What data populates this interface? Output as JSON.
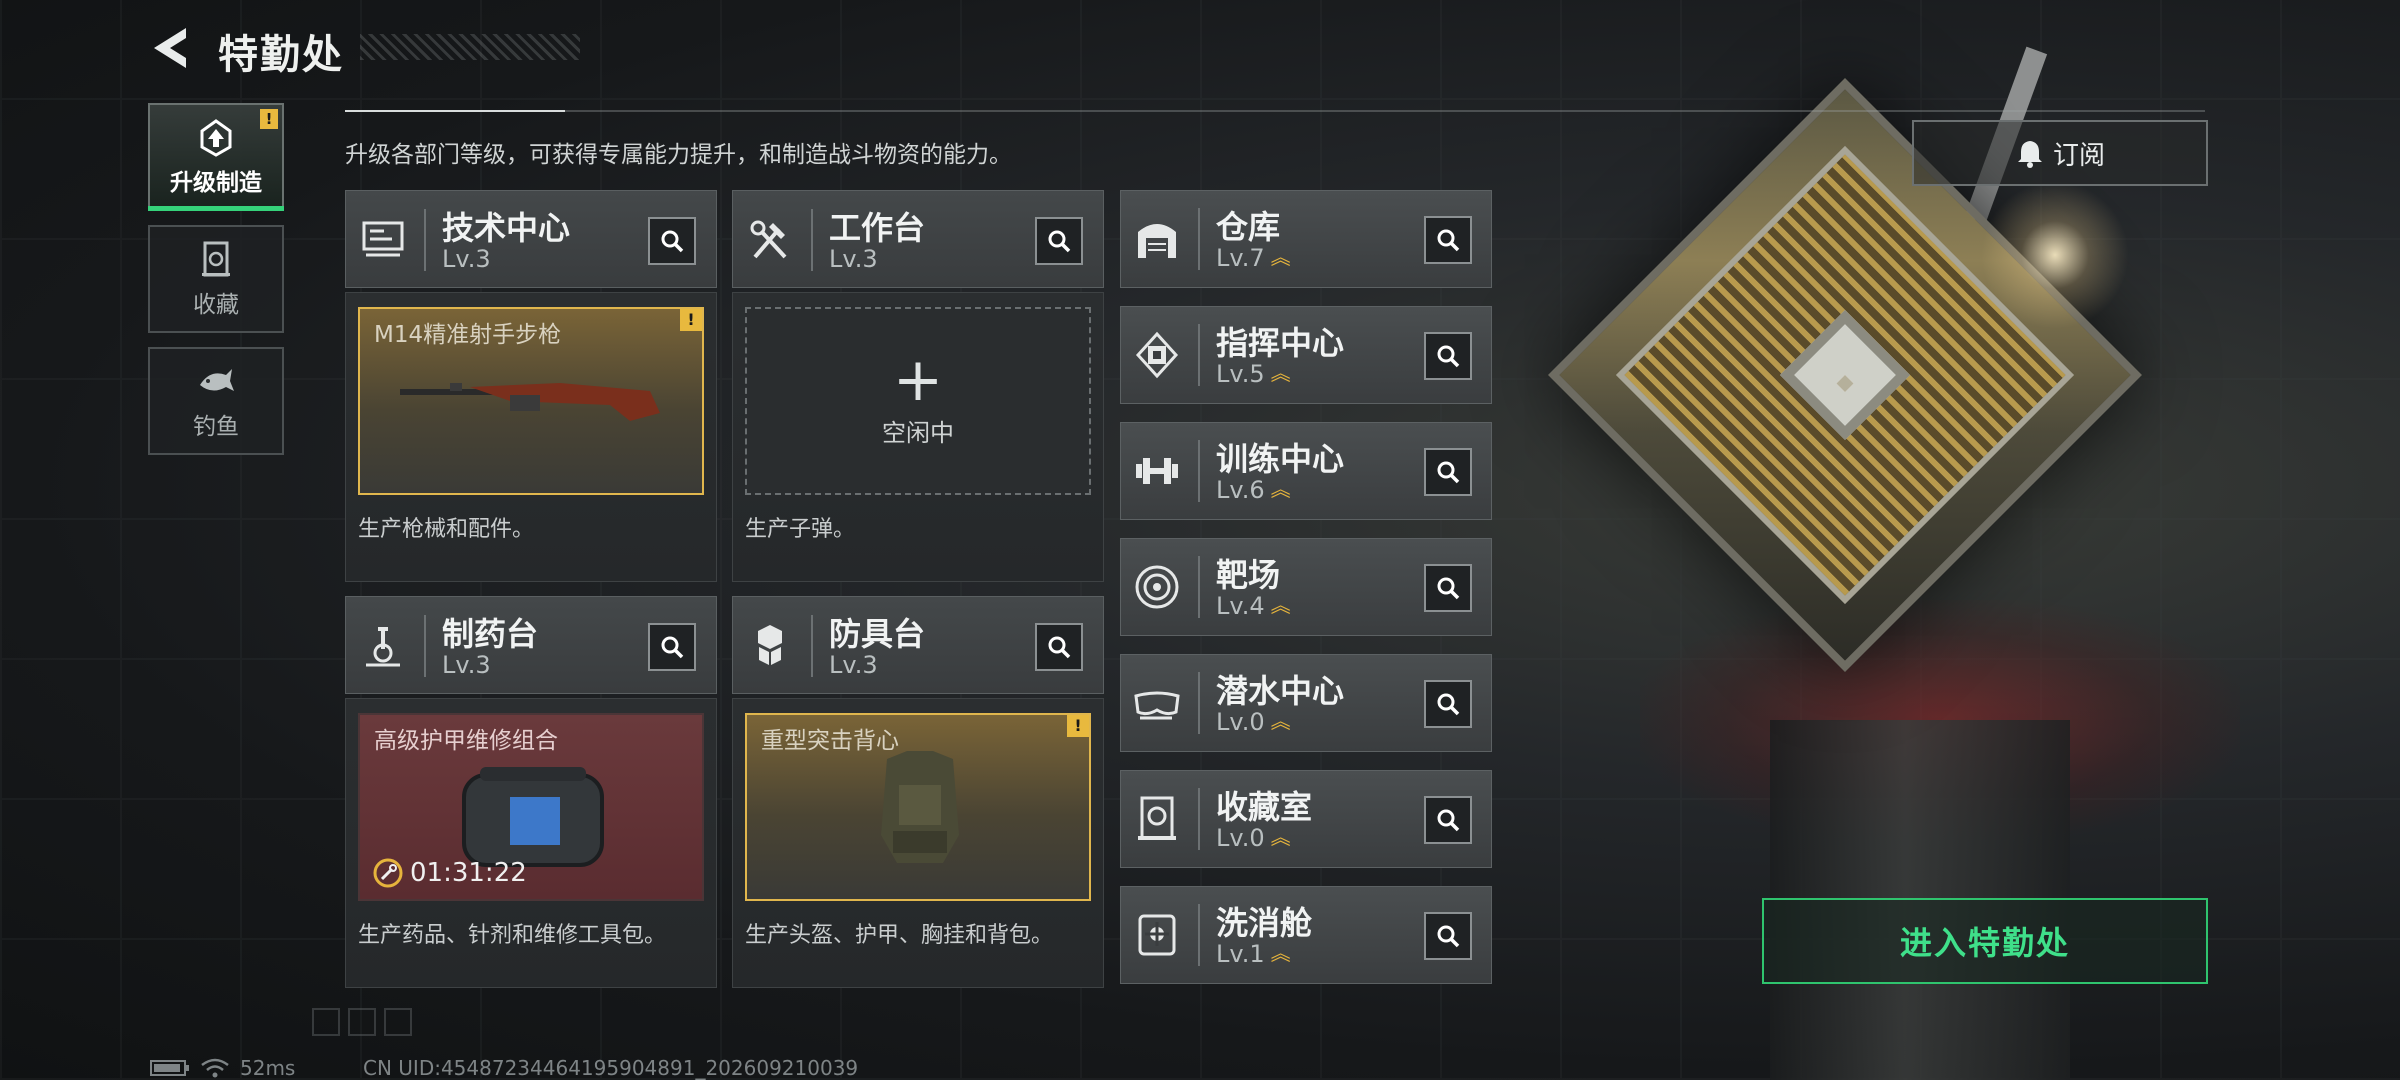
{
  "header": {
    "title": "特勤处"
  },
  "nav": [
    {
      "label": "升级制造",
      "icon": "upgrade-icon",
      "active": true,
      "alert": "!"
    },
    {
      "label": "收藏",
      "icon": "collection-icon",
      "active": false
    },
    {
      "label": "钓鱼",
      "icon": "fish-icon",
      "active": false
    }
  ],
  "description": "升级各部门等级，可获得专属能力提升，和制造战斗物资的能力。",
  "subscribe_label": "订阅",
  "workshops": [
    {
      "name": "技术中心",
      "level": "Lv.3",
      "icon": "tech-center-icon",
      "item": "M14精准射手步枪",
      "alert": "!",
      "footer": "生产枪械和配件。"
    },
    {
      "name": "工作台",
      "level": "Lv.3",
      "icon": "workbench-icon",
      "idle_label": "空闲中",
      "footer": "生产子弹。"
    },
    {
      "name": "制药台",
      "level": "Lv.3",
      "icon": "pharmacy-icon",
      "item": "高级护甲维修组合",
      "timer": "01:31:22",
      "footer": "生产药品、针剂和维修工具包。"
    },
    {
      "name": "防具台",
      "level": "Lv.3",
      "icon": "armor-bench-icon",
      "item": "重型突击背心",
      "alert": "!",
      "footer": "生产头盔、护甲、胸挂和背包。"
    }
  ],
  "facilities": [
    {
      "name": "仓库",
      "level": "Lv.7",
      "icon": "warehouse-icon"
    },
    {
      "name": "指挥中心",
      "level": "Lv.5",
      "icon": "command-center-icon"
    },
    {
      "name": "训练中心",
      "level": "Lv.6",
      "icon": "dumbbell-icon"
    },
    {
      "name": "靶场",
      "level": "Lv.4",
      "icon": "target-icon"
    },
    {
      "name": "潜水中心",
      "level": "Lv.0",
      "icon": "diving-mask-icon"
    },
    {
      "name": "收藏室",
      "level": "Lv.0",
      "icon": "collection-room-icon"
    },
    {
      "name": "洗消舱",
      "level": "Lv.1",
      "icon": "decontamination-icon"
    }
  ],
  "enter_button": "进入特勤处",
  "status": {
    "ping": "52ms",
    "uid": "CN UID:45487234464195904891_202609210039"
  },
  "colors": {
    "accent_green": "#35d27a",
    "alert_yellow": "#e8b93e",
    "upgrade_gold": "#e6b43c"
  }
}
